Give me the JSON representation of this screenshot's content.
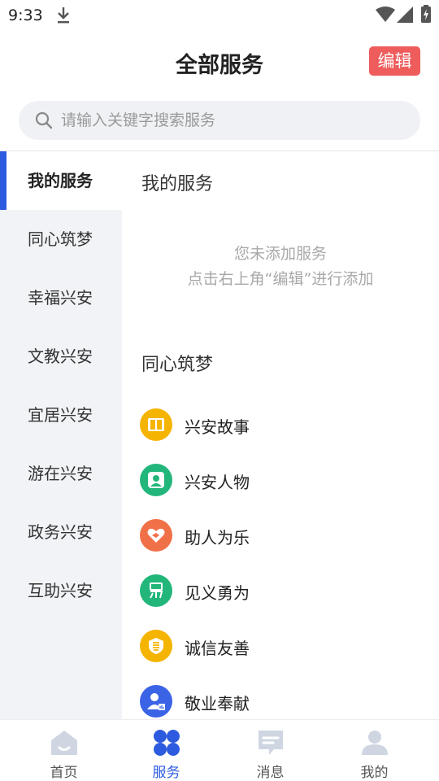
{
  "status_bar": {
    "time": "9:33"
  },
  "header": {
    "title": "全部服务",
    "edit_label": "编辑"
  },
  "search": {
    "placeholder": "请输入关键字搜索服务"
  },
  "sidebar": {
    "items": [
      {
        "label": "我的服务",
        "active": true
      },
      {
        "label": "同心筑梦"
      },
      {
        "label": "幸福兴安"
      },
      {
        "label": "文教兴安"
      },
      {
        "label": "宜居兴安"
      },
      {
        "label": "游在兴安"
      },
      {
        "label": "政务兴安"
      },
      {
        "label": "互助兴安"
      }
    ]
  },
  "main": {
    "my_services": {
      "title": "我的服务",
      "empty_line1": "您未添加服务",
      "empty_line2": "点击右上角“编辑”进行添加"
    },
    "section2": {
      "title": "同心筑梦",
      "services": [
        {
          "label": "兴安故事",
          "icon": "book-icon",
          "color": "#f5b400"
        },
        {
          "label": "兴安人物",
          "icon": "person-icon",
          "color": "#22b67b"
        },
        {
          "label": "助人为乐",
          "icon": "heart-hand-icon",
          "color": "#f07048"
        },
        {
          "label": "见义勇为",
          "icon": "brave-icon",
          "color": "#22b67b"
        },
        {
          "label": "诚信友善",
          "icon": "integrity-icon",
          "color": "#f5b400"
        },
        {
          "label": "敬业奉献",
          "icon": "worker-icon",
          "color": "#3a63e6"
        }
      ]
    }
  },
  "bottom_nav": {
    "items": [
      {
        "label": "首页",
        "icon": "home-icon"
      },
      {
        "label": "服务",
        "icon": "services-icon",
        "active": true
      },
      {
        "label": "消息",
        "icon": "message-icon"
      },
      {
        "label": "我的",
        "icon": "profile-icon"
      }
    ]
  },
  "colors": {
    "accent": "#2d5be0",
    "edit_button": "#ee5c5c",
    "sidebar_bg": "#f1f3f6"
  }
}
